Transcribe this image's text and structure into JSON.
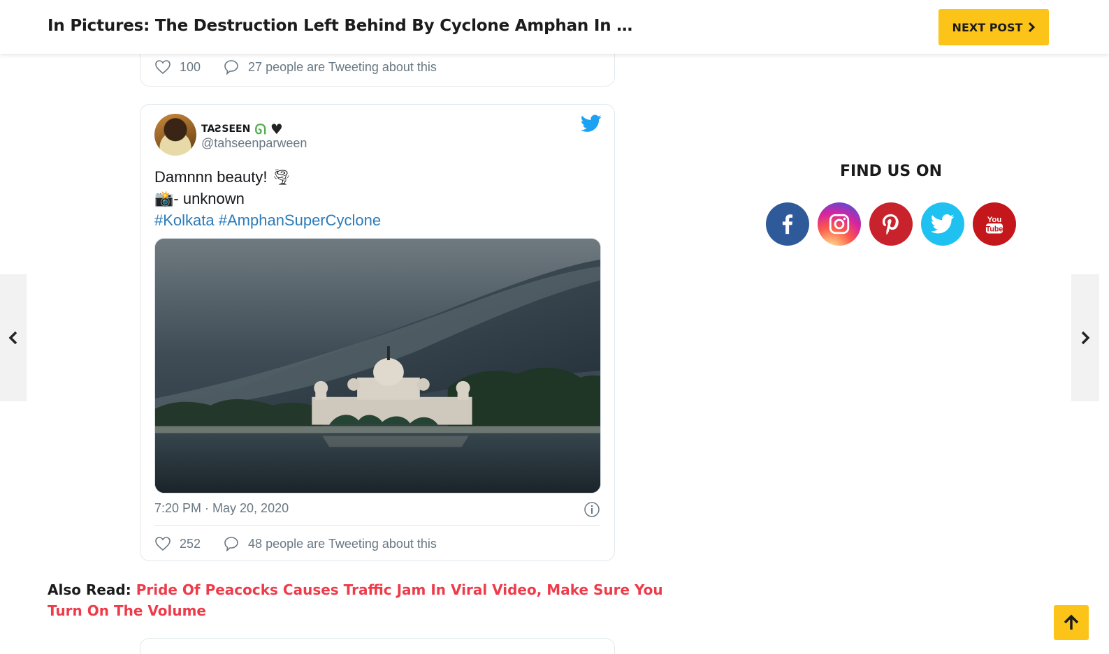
{
  "header": {
    "title": "In Pictures: The Destruction Left Behind By Cyclone Amphan In Kolkata",
    "next_post_label": "NEXT POST"
  },
  "tweet_previous": {
    "likes": "100",
    "tweeting": "27 people are Tweeting about this"
  },
  "tweet": {
    "author_name": "TAƧSEEN",
    "handle": "@tahseenparween",
    "text_line1": "Damnnn beauty! 🌪",
    "text_line2": "📸- unknown",
    "hashtag1": "#Kolkata",
    "hashtag2": "#AmphanSuperCyclone",
    "timestamp": "7:20 PM · May 20, 2020",
    "likes": "252",
    "tweeting": "48 people are Tweeting about this"
  },
  "also_read": {
    "label": "Also Read:",
    "link_text": "Pride Of Peacocks Causes Traffic Jam In Viral Video, Make Sure You Turn On The Volume"
  },
  "sidebar": {
    "find_us_title": "FIND US ON",
    "socials": [
      {
        "name": "facebook",
        "color": "#2f5a9a"
      },
      {
        "name": "instagram",
        "color": "#e1306c"
      },
      {
        "name": "pinterest",
        "color": "#c8232c"
      },
      {
        "name": "twitter",
        "color": "#1ec1f0"
      },
      {
        "name": "youtube",
        "color": "#c4171c"
      }
    ]
  },
  "colors": {
    "accent_yellow": "#fcc419",
    "link_red": "#ee3b4a",
    "twitter_blue": "#1da1f2"
  }
}
